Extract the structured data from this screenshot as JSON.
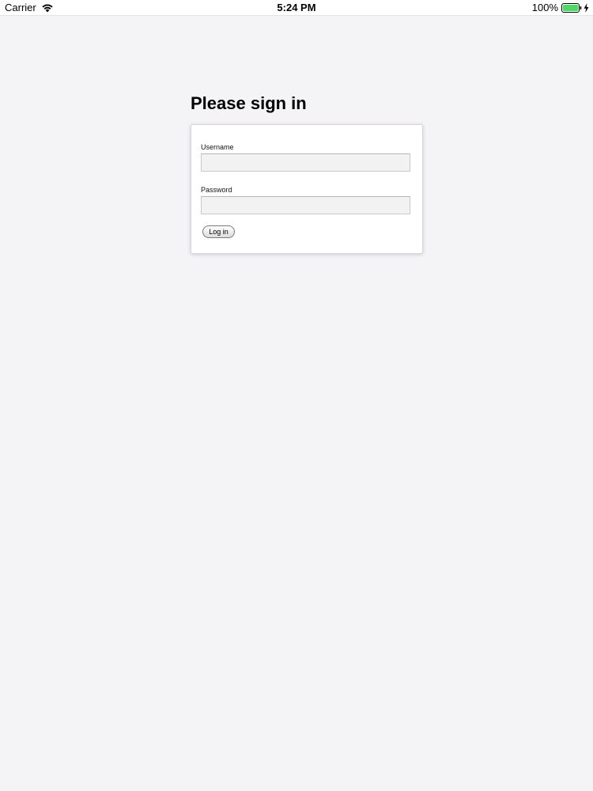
{
  "status_bar": {
    "carrier": "Carrier",
    "time": "5:24 PM",
    "battery_percent": "100%",
    "battery_level": 1.0,
    "battery_color": "#4cd964",
    "icons": [
      "wifi-icon",
      "battery-icon",
      "charging-icon"
    ]
  },
  "page": {
    "title": "Please sign in"
  },
  "form": {
    "username_label": "Username",
    "username_value": "",
    "password_label": "Password",
    "password_value": "",
    "login_button_label": "Log in"
  }
}
